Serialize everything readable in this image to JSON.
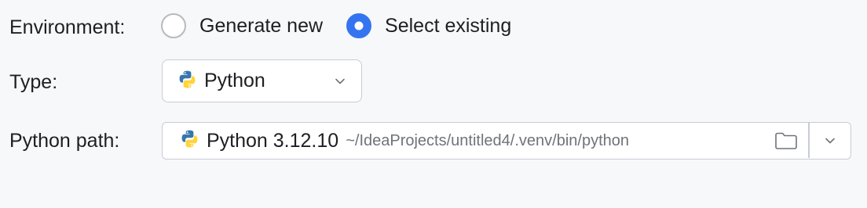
{
  "environment": {
    "label": "Environment:",
    "options": [
      {
        "label": "Generate new",
        "selected": false
      },
      {
        "label": "Select existing",
        "selected": true
      }
    ]
  },
  "type": {
    "label": "Type:",
    "selected": "Python",
    "icon": "python-icon"
  },
  "python_path": {
    "label": "Python path:",
    "interpreter": "Python 3.12.10",
    "path": "~/IdeaProjects/untitled4/.venv/bin/python",
    "icons": [
      "python-icon",
      "folder-icon",
      "chevron-down-icon"
    ]
  },
  "colors": {
    "accent": "#3574f0",
    "background": "#f7f8fa",
    "border": "#c9ccd6",
    "muted_text": "#6f737a"
  }
}
